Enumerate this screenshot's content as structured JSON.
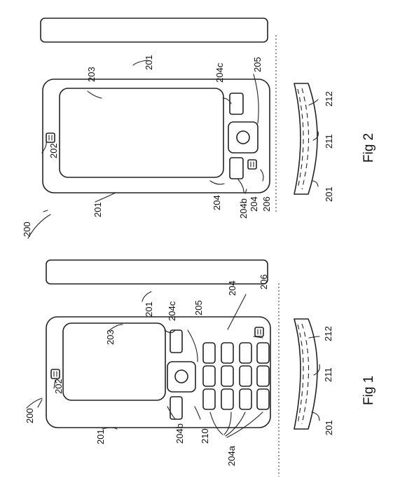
{
  "figure1": {
    "caption": "Fig 1",
    "labels": {
      "device": "200",
      "housing": "201",
      "earpiece": "202",
      "display": "203",
      "keypad": "204",
      "keys": "204a",
      "softkey_left": "204b",
      "softkey_right": "204c",
      "navigation_key": "205",
      "microphone": "206",
      "front_cover": "210",
      "side_view_housing": "201",
      "side_view_layer_outer": "211",
      "side_view_layer_inner": "212"
    }
  },
  "figure2": {
    "caption": "Fig 2",
    "labels": {
      "device": "200",
      "housing": "201",
      "earpiece": "202",
      "display": "203",
      "keypad": "204",
      "softkey_left": "204b",
      "softkey_right": "204c",
      "navigation_key": "205",
      "microphone": "206",
      "display_lower": "204",
      "side_view_housing": "201",
      "side_view_layer_outer": "211",
      "side_view_layer_inner": "212"
    }
  }
}
